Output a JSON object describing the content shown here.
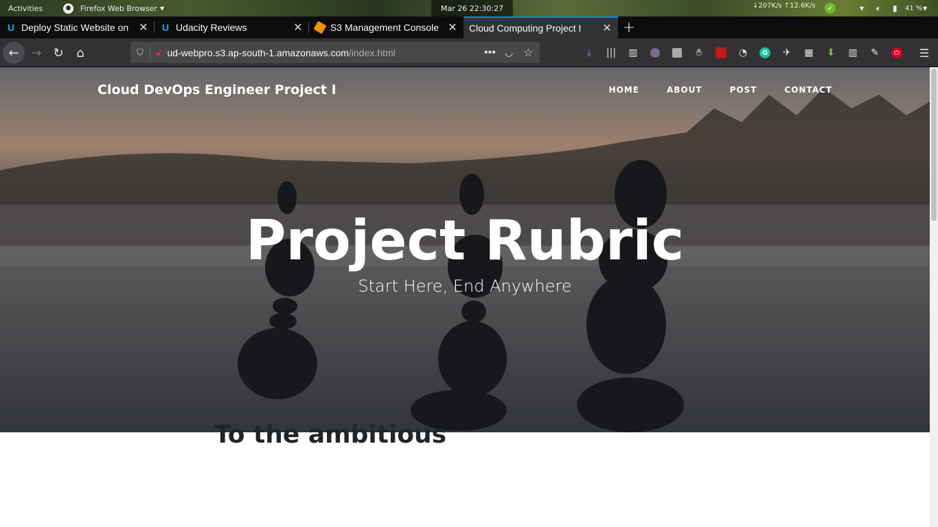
{
  "system_bar": {
    "activities": "Activities",
    "app_menu": "Firefox Web Browser",
    "clock": "Mar 26  22:30:27",
    "net_speed": "↓207K/s ↑12.6K/s",
    "battery": "41 %"
  },
  "tabs": [
    {
      "title": "Deploy Static Website on",
      "icon": "udacity-icon",
      "active": false
    },
    {
      "title": "Udacity Reviews",
      "icon": "udacity-icon",
      "active": false
    },
    {
      "title": "S3 Management Console",
      "icon": "aws-icon",
      "active": false
    },
    {
      "title": "Cloud Computing Project I",
      "icon": "none",
      "active": true
    }
  ],
  "urlbar": {
    "host": "ud-webpro.s3.ap-south-1.amazonaws.com",
    "path": "/index.html"
  },
  "site": {
    "brand": "Cloud DevOps Engineer Project I",
    "nav": [
      "HOME",
      "ABOUT",
      "POST",
      "CONTACT"
    ],
    "hero_title": "Project Rubric",
    "hero_subtitle": "Start Here, End Anywhere",
    "section_heading": "To the ambitious"
  },
  "colors": {
    "tab_accent": "#0a84ff",
    "toolbar_bg": "#323234",
    "tabstrip_bg": "#0c0c0d"
  }
}
